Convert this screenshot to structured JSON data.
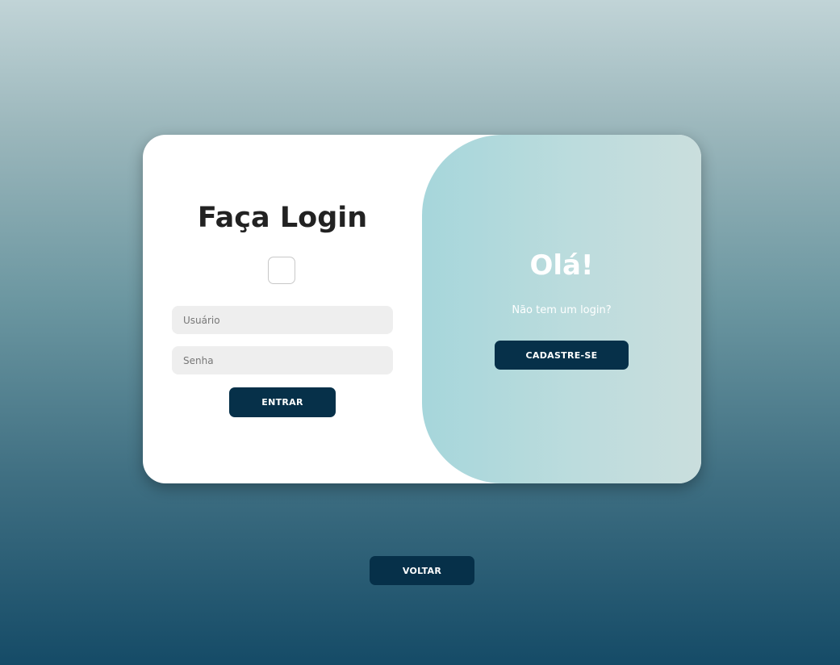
{
  "login": {
    "title": "Faça Login",
    "username_placeholder": "Usuário",
    "password_placeholder": "Senha",
    "submit_label": "ENTRAR"
  },
  "welcome": {
    "title": "Olá!",
    "prompt": "Não tem um login?",
    "signup_label": "CADASTRE-SE"
  },
  "footer": {
    "back_label": "VOLTAR"
  },
  "colors": {
    "button_bg": "#063049",
    "panel_gradient_start": "#a6d6db",
    "panel_gradient_end": "#cadedd",
    "page_gradient_top": "#c1d4d7",
    "page_gradient_bottom": "#154b67"
  }
}
